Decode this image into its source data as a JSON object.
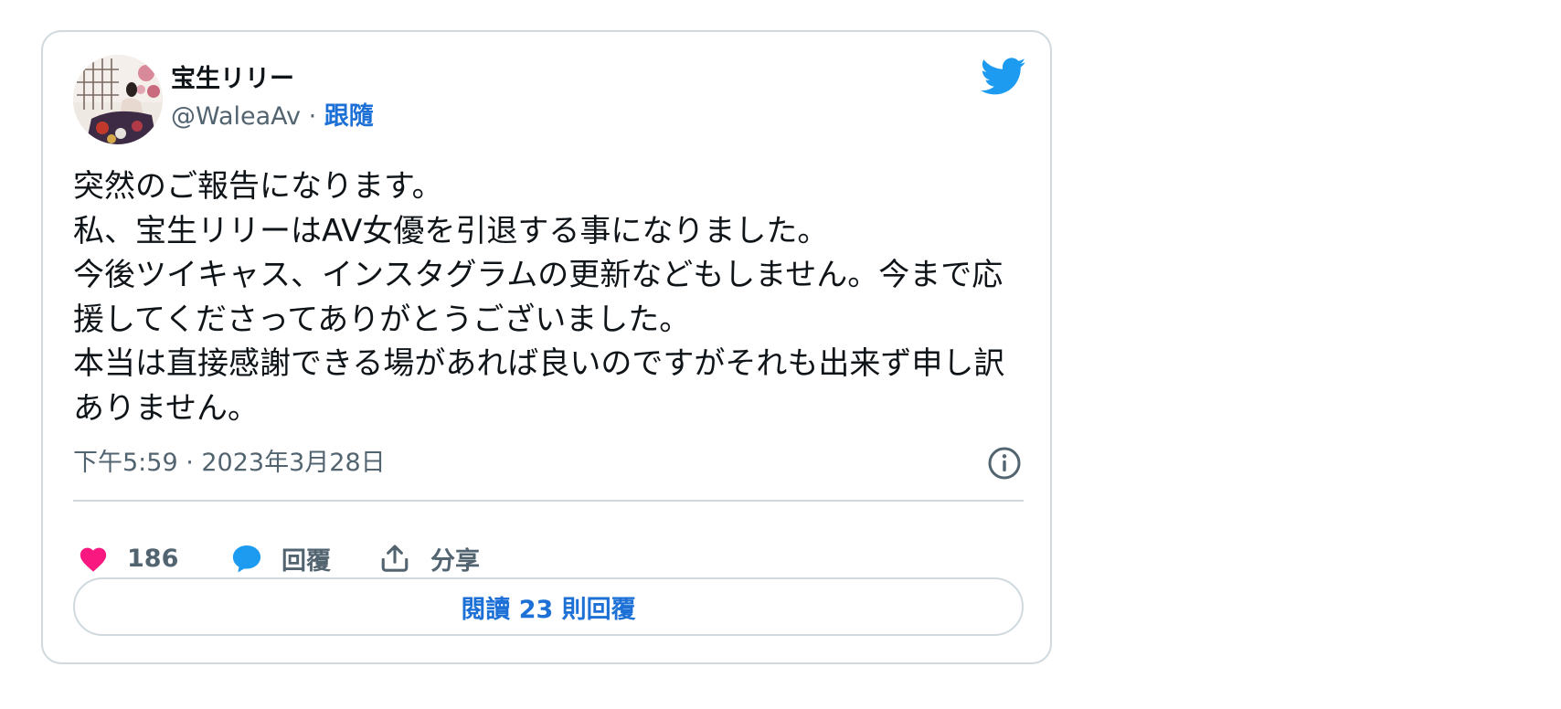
{
  "author": {
    "display_name": "宝生リリー",
    "handle": "@WaleaAv",
    "separator": " · ",
    "follow_label": "跟隨"
  },
  "tweet": {
    "text": "突然のご報告になります。\n私、宝生リリーはAV女優を引退する事になりました。\n今後ツイキャス、インスタグラムの更新などもしません。今まで応援してくださってありがとうございました。\n本当は直接感謝できる場があれば良いのですがそれも出来ず申し訳ありません。",
    "timestamp": "下午5:59 · 2023年3月28日"
  },
  "actions": {
    "like_count": "186",
    "reply_label": "回覆",
    "share_label": "分享"
  },
  "read_replies_label": "閱讀 23 則回覆",
  "icons": {
    "brand": "twitter-bird-icon",
    "info": "info-icon",
    "like": "heart-icon",
    "reply": "speech-bubble-icon",
    "share": "share-upload-icon"
  },
  "colors": {
    "link": "#1d70d6",
    "twitter_blue": "#1d9bf0",
    "like_pink": "#f91880",
    "muted_text": "#536471",
    "border": "#cfd9de"
  }
}
